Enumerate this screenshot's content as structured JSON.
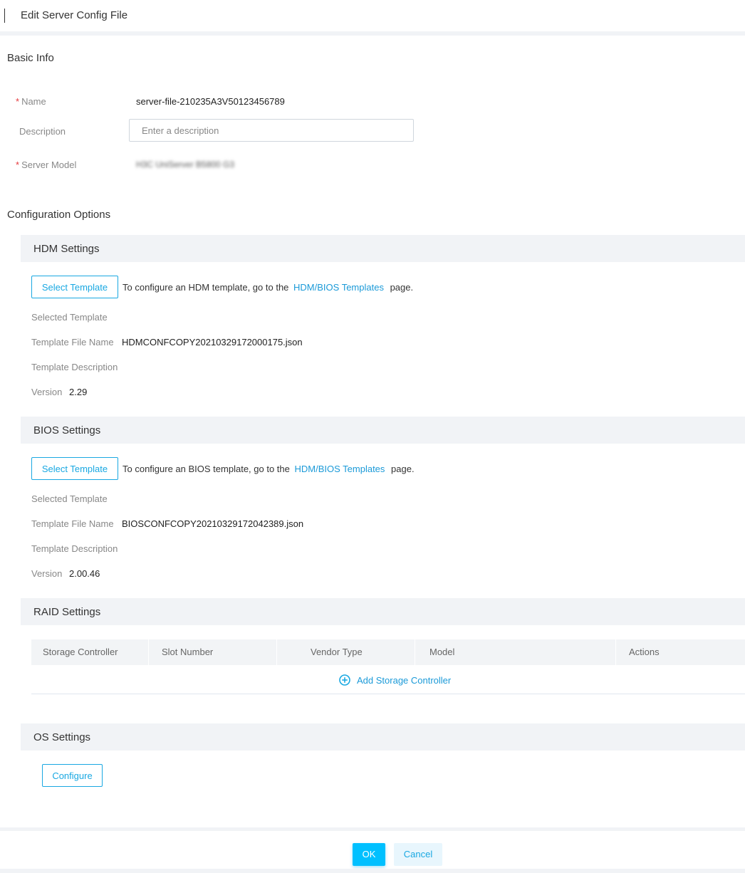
{
  "header": {
    "title": "Edit Server Config File"
  },
  "basic_info": {
    "section_title": "Basic Info",
    "name_label": "Name",
    "name_value": "server-file-210235A3V50123456789",
    "description_label": "Description",
    "description_placeholder": "Enter a description",
    "server_model_label": "Server Model",
    "server_model_value": "H3C UniServer B5800 G3"
  },
  "configuration": {
    "section_title": "Configuration Options",
    "hdm": {
      "title": "HDM Settings",
      "select_button": "Select Template",
      "hint_prefix": "To configure an HDM template, go to the",
      "hint_link": "HDM/BIOS Templates",
      "hint_suffix": "page.",
      "selected_template_label": "Selected Template",
      "file_name_label": "Template File Name",
      "file_name_value": "HDMCONFCOPY20210329172000175.json",
      "description_label": "Template Description",
      "version_label": "Version",
      "version_value": "2.29"
    },
    "bios": {
      "title": "BIOS Settings",
      "select_button": "Select Template",
      "hint_prefix": "To configure an BIOS template, go to the",
      "hint_link": "HDM/BIOS Templates",
      "hint_suffix": "page.",
      "selected_template_label": "Selected Template",
      "file_name_label": "Template File Name",
      "file_name_value": "BIOSCONFCOPY20210329172042389.json",
      "description_label": "Template Description",
      "version_label": "Version",
      "version_value": "2.00.46"
    },
    "raid": {
      "title": "RAID Settings",
      "columns": [
        "Storage Controller",
        "Slot Number",
        "Vendor Type",
        "Model",
        "Actions"
      ],
      "add_label": "Add Storage Controller",
      "add_icon": "plus-circle-icon"
    },
    "os": {
      "title": "OS Settings",
      "configure_button": "Configure"
    }
  },
  "footer": {
    "ok_label": "OK",
    "cancel_label": "Cancel"
  },
  "colors": {
    "accent": "#19a8e2",
    "primary_button": "#00c0ff",
    "required": "#e5393d",
    "section_band": "#f1f3f6"
  }
}
